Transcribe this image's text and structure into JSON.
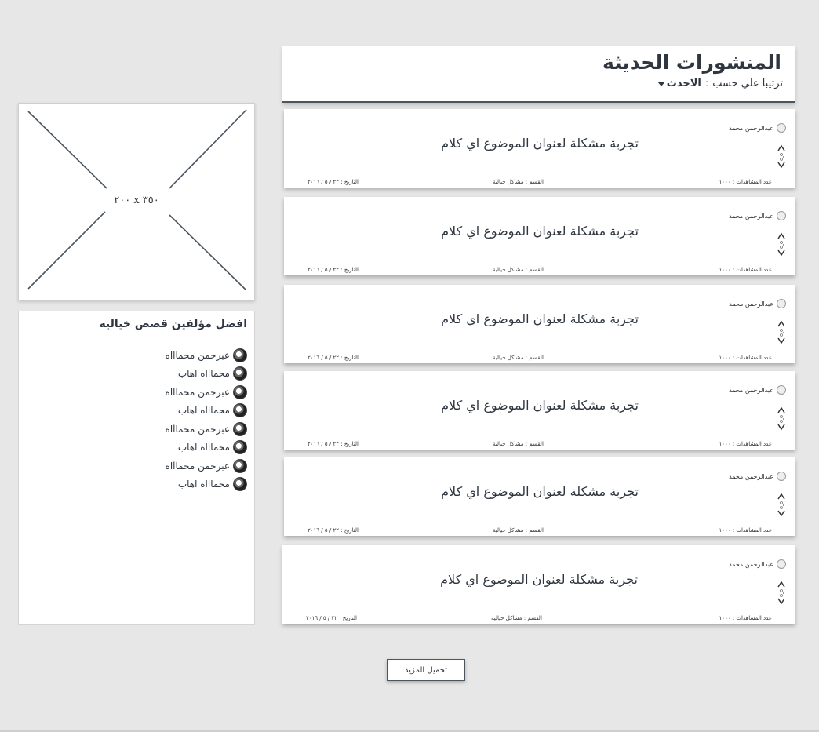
{
  "header": {
    "title": "المنشورات الحديثة",
    "sort_label": "ترتيبا علي حسب",
    "sort_sep": ":",
    "sort_value": "الاحدث"
  },
  "posts": [
    {
      "author": "عبدالرحمن محمد",
      "title": "تجربة مشكلة لعنوان الموضوع اي كلام",
      "views": "عدد المشاهدات : ١٠٠٠",
      "category": "القسم : مشاكل خيالية",
      "date": "التاريخ : ٢٢ / ٥ / ٢٠١٦"
    },
    {
      "author": "عبدالرحمن محمد",
      "title": "تجربة مشكلة لعنوان الموضوع اي كلام",
      "views": "عدد المشاهدات : ١٠٠٠",
      "category": "القسم : مشاكل خيالية",
      "date": "التاريخ : ٢٢ / ٥ / ٢٠١٦"
    },
    {
      "author": "عبدالرحمن محمد",
      "title": "تجربة مشكلة لعنوان الموضوع اي كلام",
      "views": "عدد المشاهدات : ١٠٠٠",
      "category": "القسم : مشاكل خيالية",
      "date": "التاريخ : ٢٢ / ٥ / ٢٠١٦"
    },
    {
      "author": "عبدالرحمن محمد",
      "title": "تجربة مشكلة لعنوان الموضوع اي كلام",
      "views": "عدد المشاهدات : ١٠٠٠",
      "category": "القسم : مشاكل خيالية",
      "date": "التاريخ : ٢٢ / ٥ / ٢٠١٦"
    },
    {
      "author": "عبدالرحمن محمد",
      "title": "تجربة مشكلة لعنوان الموضوع اي كلام",
      "views": "عدد المشاهدات : ١٠٠٠",
      "category": "القسم : مشاكل خيالية",
      "date": "التاريخ : ٢٢ / ٥ / ٢٠١٦"
    },
    {
      "author": "عبدالرحمن محمد",
      "title": "تجربة مشكلة لعنوان الموضوع اي كلام",
      "views": "عدد المشاهدات : ١٠٠٠",
      "category": "القسم : مشاكل خيالية",
      "date": "التاريخ : ٢٢ / ٥ / ٢٠١٦"
    }
  ],
  "ad": {
    "label": "٢٠٠ x ٣٥٠"
  },
  "top_authors": {
    "heading": "افضل مؤلفين قصص خيالية",
    "items": [
      "عبرحمن محماlاه",
      "محماlاه اهاب",
      "عبرحمن محماlاه",
      "محماlاه اهاب",
      "عبرحمن محماlاه",
      "محماlاه اهاب",
      "عبرحمن محماlاه",
      "محماlاه اهاب"
    ]
  },
  "load_more": "تحميل المزيد",
  "icons": {
    "vote": "vote-arrows-icon",
    "author_avatar": "avatar-icon",
    "sort": "triangle-down-icon"
  }
}
